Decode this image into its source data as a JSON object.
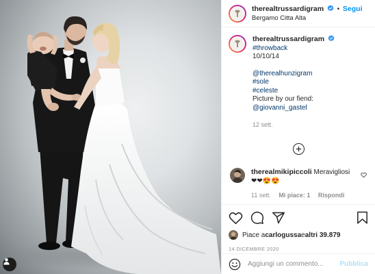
{
  "post": {
    "author": "therealtrussardigram",
    "verified": true,
    "follow_label": "Segui",
    "separator": "•",
    "location": "Bergamo Citta Alta"
  },
  "caption": {
    "author": "therealtrussardigram",
    "hashtag": "#throwback",
    "date_text": "10/10/14",
    "lines": [
      {
        "text": "@therealhunzigram",
        "type": "mention"
      },
      {
        "text": "#sole",
        "type": "hashtag"
      },
      {
        "text": "#celeste",
        "type": "hashtag"
      },
      {
        "text": "Picture by our fiend:",
        "type": "text"
      },
      {
        "text": "@giovanni_gastel",
        "type": "mention"
      }
    ],
    "time_ago": "12 sett."
  },
  "comments": [
    {
      "author": "therealmikipiccoli",
      "text": "Meravigliosi",
      "emojis": "❤❤😍😍",
      "time_ago": "11 sett.",
      "likes": "Mi piace: 1",
      "reply_label": "Rispondi"
    }
  ],
  "actions": {
    "icons": [
      "heart-icon",
      "comment-icon",
      "share-icon",
      "bookmark-icon"
    ],
    "likes_prefix": "Piace a ",
    "liked_by": "carlogussa",
    "likes_middle": " e ",
    "likes_others": "altri 39.879",
    "post_date": "14 DICEMBRE 2020"
  },
  "add_comment": {
    "placeholder": "Aggiungi un commento...",
    "publish_label": "Pubblica"
  },
  "colors": {
    "link": "#00376b",
    "follow": "#0095f6",
    "publish_disabled": "#b2dffc",
    "verified": "#3897f0",
    "muted": "#8e8e8e"
  }
}
